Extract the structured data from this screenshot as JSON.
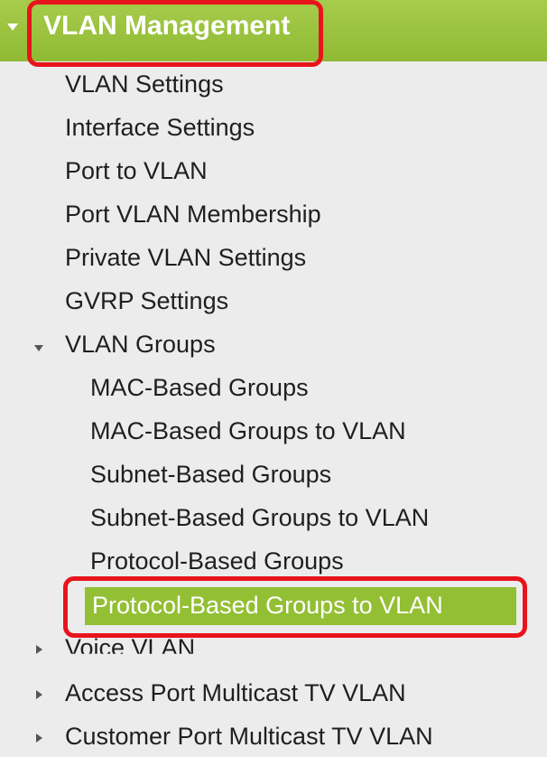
{
  "header": {
    "title": "VLAN Management"
  },
  "nav": {
    "items": [
      "VLAN Settings",
      "Interface Settings",
      "Port to VLAN",
      "Port VLAN Membership",
      "Private VLAN Settings",
      "GVRP Settings"
    ],
    "groups": {
      "label": "VLAN Groups",
      "children": [
        "MAC-Based Groups",
        "MAC-Based Groups to VLAN",
        "Subnet-Based Groups",
        "Subnet-Based Groups to VLAN",
        "Protocol-Based Groups",
        "Protocol-Based Groups to VLAN"
      ]
    },
    "collapsed": [
      "Voice VLAN",
      "Access Port Multicast TV VLAN",
      "Customer Port Multicast TV VLAN"
    ]
  },
  "highlight_color": "#e8141c",
  "accent_color": "#93bf35"
}
